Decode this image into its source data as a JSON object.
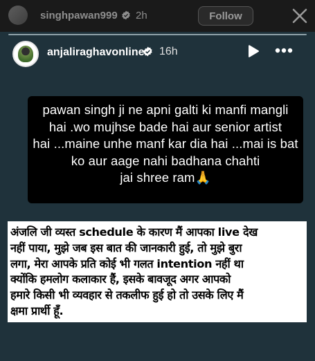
{
  "outer_story": {
    "username": "singhpawan999",
    "time": "2h",
    "follow_label": "Follow"
  },
  "story": {
    "username": "anjaliraghavonline",
    "time": "16h"
  },
  "quote_box": {
    "text": "pawan singh ji ne apni galti ki manfi mangli\nhai .wo mujhse bade hai aur senior artist\nhai ...maine unhe manf kar dia hai ...mai is bat\nko aur aage nahi badhana chahti\njai shree ram🙏"
  },
  "hindi_box": {
    "text": "अंजलि जी व्यस्त schedule के कारण मैं आपका live देख\nनहीं पाया,  मुझे जब इस बात की जानकारी हुई,  तो मुझे बुरा\nलगा,  मेरा आपके प्रति कोई भी गलत intention नहीं था\nक्योंकि हमलोग कलाकार हैं,  इसके बावजूद अगर आपको\nहमारे  किसी भी व्यवहार से तकलीफ हुई हो तो उसके लिए मैं\nक्षमा प्रार्थी हूँ."
  },
  "icons": [
    "flag-avatar-icon",
    "verified-badge-icon",
    "close-icon",
    "avatar-icon",
    "play-icon",
    "more-options-icon"
  ],
  "colors": {
    "story_background": "#1f323b",
    "verified_blue": "#0095f6"
  }
}
